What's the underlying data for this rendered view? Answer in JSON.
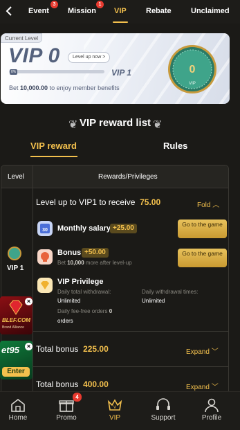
{
  "tabs": [
    {
      "label": "Event",
      "badge": "3"
    },
    {
      "label": "Mission",
      "badge": "1"
    },
    {
      "label": "VIP",
      "active": true
    },
    {
      "label": "Rebate"
    },
    {
      "label": "Unclaimed"
    }
  ],
  "vip_card": {
    "current_level_label": "Current Level",
    "title": "VIP 0",
    "level_up_button": "Level up now >",
    "progress_percent": 0,
    "progress_label": "0%",
    "next_level": "VIP 1",
    "bet_prefix": "Bet ",
    "bet_amount": "10,000.00",
    "bet_suffix": " to enjoy member benefits",
    "coin_level": "0",
    "coin_text": "VIP"
  },
  "reward_list": {
    "title": "VIP reward list",
    "tab_active": "VIP reward",
    "tab_other": "Rules"
  },
  "table": {
    "col_level": "Level",
    "col_rewards": "Rewards/Privileges",
    "row1": {
      "level": "VIP 1",
      "title_prefix": "Level up to VIP1 to receive",
      "title_amount": "75.00",
      "toggle": "Fold",
      "monthly_label": "Monthly salary",
      "monthly_icon_text": "30",
      "monthly_amount": "+25.00",
      "monthly_button": "Go to the game",
      "bonus_label": "Bonus",
      "bonus_amount": "+50.00",
      "bonus_sub_prefix": "Bet ",
      "bonus_sub_amount": "10,000",
      "bonus_sub_suffix": " more after level-up",
      "bonus_button": "Go to the game",
      "privilege_label": "VIP Privilege",
      "withdrawal_label": "Daily total withdrawal:",
      "withdrawal_value": "Unlimited",
      "times_label": "Daily withdrawal times:",
      "times_value": "Unlimited",
      "feefree_label": "Daily fee-free orders",
      "feefree_value": "0",
      "feefree_unit": "orders"
    },
    "row2": {
      "title_prefix": "Total bonus",
      "title_amount": "225.00",
      "toggle": "Expand"
    },
    "row3": {
      "title_prefix": "Total bonus",
      "title_amount": "400.00",
      "toggle": "Expand"
    }
  },
  "ads": {
    "ad1_text": "BLEF.COM",
    "ad1_sub": "Brand Alliance",
    "ad2_text": "et95",
    "ad2_button": "Enter"
  },
  "bottom_nav": [
    {
      "label": "Home",
      "icon": "home-icon"
    },
    {
      "label": "Promo",
      "icon": "gift-icon",
      "badge": "4"
    },
    {
      "label": "VIP",
      "icon": "crown-icon",
      "active": true
    },
    {
      "label": "Support",
      "icon": "headset-icon"
    },
    {
      "label": "Profile",
      "icon": "person-icon"
    }
  ],
  "colors": {
    "accent": "#f3c04d",
    "background": "#1b1a17",
    "badge": "#e83a2f"
  }
}
